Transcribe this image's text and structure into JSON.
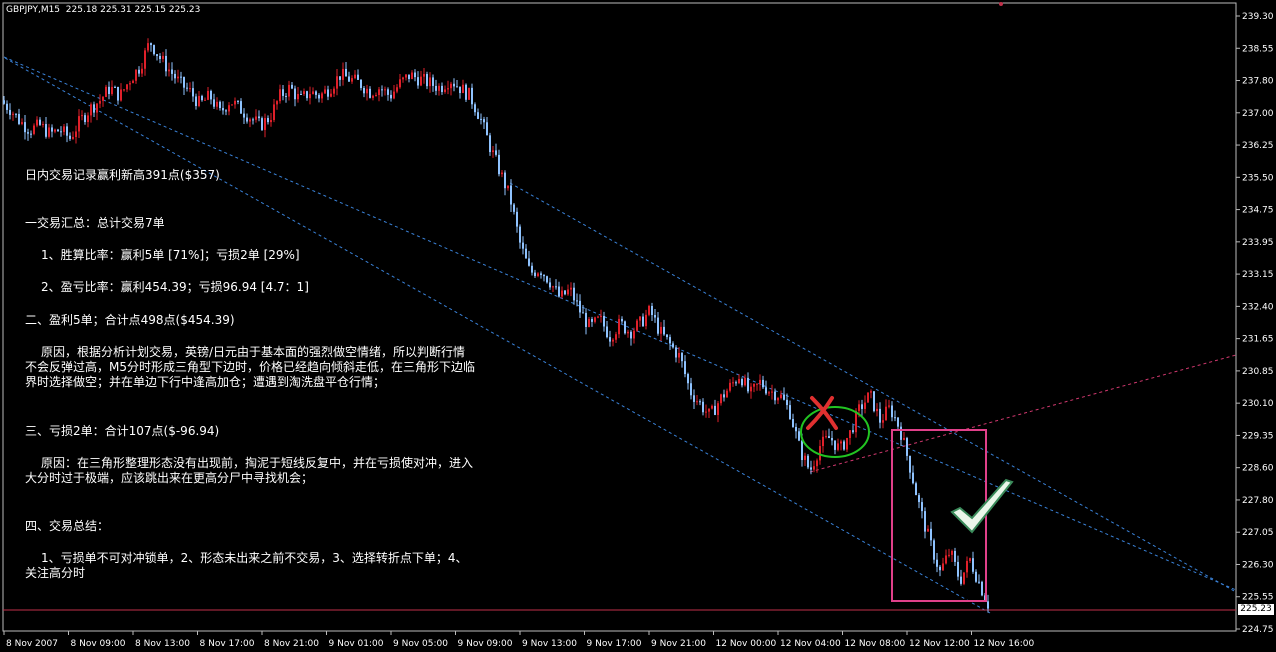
{
  "header": {
    "symbol": "GBPJPY,M15",
    "ohlc": "225.18 225.31 225.15 225.23"
  },
  "notes": {
    "title": "日内交易记录赢利新高391点($357)",
    "s1_title": "一交易汇总：总计交易7单",
    "s1_item1": "1、胜算比率：赢利5单 [71%]；亏损2单 [29%]",
    "s1_item2": "2、盈亏比率：赢利454.39；亏损96.94 [4.7：1]",
    "s2_title": "二、盈利5单；合计点498点($454.39)",
    "s2_reason": "原因，根据分析计划交易，英镑/日元由于基本面的强烈做空情绪，所以判断行情不会反弹过高，M5分时形成三角型下边时，价格已经趋向倾斜走低，在三角形下边临界时选择做空；并在单边下行中逢高加仓；遭遇到淘洗盘平仓行情；",
    "s3_title": "三、亏损2单：合计107点($-96.94)",
    "s3_reason": "原因：在三角形整理形态没有出现前，掏泥于短线反复中，并在亏损使对冲，进入大分时过于极端，应该跳出来在更高分尸中寻找机会；",
    "s4_title": "四、交易总结：",
    "s4_items": "1、亏损单不可对冲锁单，2、形态未出来之前不交易，3、选择转折点下单；4、关注高分时"
  },
  "current_price": "225.23",
  "chart_data": {
    "type": "candlestick",
    "symbol": "GBPJPY",
    "timeframe": "M15",
    "ylim": [
      224.75,
      239.3
    ],
    "y_ticks": [
      "239.30",
      "238.55",
      "237.80",
      "237.00",
      "236.25",
      "235.50",
      "234.75",
      "233.95",
      "233.15",
      "232.40",
      "231.65",
      "230.85",
      "230.10",
      "229.35",
      "228.60",
      "227.80",
      "227.05",
      "226.30",
      "225.55",
      "224.75"
    ],
    "x_ticks": [
      "8 Nov 2007",
      "8 Nov 09:00",
      "8 Nov 13:00",
      "8 Nov 17:00",
      "8 Nov 21:00",
      "9 Nov 01:00",
      "9 Nov 05:00",
      "9 Nov 09:00",
      "9 Nov 13:00",
      "9 Nov 17:00",
      "9 Nov 21:00",
      "12 Nov 00:00",
      "12 Nov 04:00",
      "12 Nov 08:00",
      "12 Nov 12:00",
      "12 Nov 16:00"
    ],
    "close_path": [
      [
        0,
        237.3
      ],
      [
        10,
        237.1
      ],
      [
        20,
        236.8
      ],
      [
        30,
        236.6
      ],
      [
        40,
        236.7
      ],
      [
        50,
        236.5
      ],
      [
        60,
        236.6
      ],
      [
        70,
        236.4
      ],
      [
        80,
        236.8
      ],
      [
        90,
        237.1
      ],
      [
        100,
        237.3
      ],
      [
        110,
        237.6
      ],
      [
        120,
        237.4
      ],
      [
        130,
        237.8
      ],
      [
        140,
        238.1
      ],
      [
        150,
        238.7
      ],
      [
        160,
        238.3
      ],
      [
        170,
        238.0
      ],
      [
        180,
        237.7
      ],
      [
        190,
        237.5
      ],
      [
        200,
        237.2
      ],
      [
        210,
        237.4
      ],
      [
        220,
        237.0
      ],
      [
        230,
        237.3
      ],
      [
        240,
        237.1
      ],
      [
        250,
        236.9
      ],
      [
        260,
        236.7
      ],
      [
        270,
        236.9
      ],
      [
        280,
        237.4
      ],
      [
        290,
        237.6
      ],
      [
        300,
        237.3
      ],
      [
        310,
        237.5
      ],
      [
        320,
        237.4
      ],
      [
        330,
        237.6
      ],
      [
        340,
        237.9
      ],
      [
        350,
        237.8
      ],
      [
        360,
        237.7
      ],
      [
        370,
        237.5
      ],
      [
        380,
        237.6
      ],
      [
        390,
        237.4
      ],
      [
        400,
        237.7
      ],
      [
        410,
        237.9
      ],
      [
        420,
        237.8
      ],
      [
        430,
        237.7
      ],
      [
        440,
        237.6
      ],
      [
        450,
        237.8
      ],
      [
        460,
        237.6
      ],
      [
        470,
        237.4
      ],
      [
        480,
        236.9
      ],
      [
        490,
        236.2
      ],
      [
        500,
        235.6
      ],
      [
        510,
        235.0
      ],
      [
        520,
        233.9
      ],
      [
        530,
        233.2
      ],
      [
        540,
        233.3
      ],
      [
        550,
        233.0
      ],
      [
        560,
        232.6
      ],
      [
        570,
        232.8
      ],
      [
        580,
        232.3
      ],
      [
        590,
        231.9
      ],
      [
        600,
        232.1
      ],
      [
        610,
        231.7
      ],
      [
        620,
        232.0
      ],
      [
        630,
        231.8
      ],
      [
        640,
        232.0
      ],
      [
        650,
        232.3
      ],
      [
        660,
        231.8
      ],
      [
        670,
        231.5
      ],
      [
        680,
        231.2
      ],
      [
        690,
        230.4
      ],
      [
        700,
        230.1
      ],
      [
        710,
        229.8
      ],
      [
        720,
        230.2
      ],
      [
        730,
        230.5
      ],
      [
        740,
        230.8
      ],
      [
        750,
        230.3
      ],
      [
        760,
        230.6
      ],
      [
        770,
        230.4
      ],
      [
        780,
        230.3
      ],
      [
        790,
        229.9
      ],
      [
        800,
        229.0
      ],
      [
        810,
        228.5
      ],
      [
        820,
        229.1
      ],
      [
        830,
        229.3
      ],
      [
        840,
        229.0
      ],
      [
        850,
        229.4
      ],
      [
        860,
        230.0
      ],
      [
        870,
        230.3
      ],
      [
        880,
        229.7
      ],
      [
        890,
        230.0
      ],
      [
        900,
        229.5
      ],
      [
        910,
        228.6
      ],
      [
        920,
        227.6
      ],
      [
        930,
        226.8
      ],
      [
        940,
        226.1
      ],
      [
        950,
        226.6
      ],
      [
        960,
        225.9
      ],
      [
        970,
        226.4
      ],
      [
        980,
        225.8
      ],
      [
        990,
        225.23
      ]
    ],
    "annotations": [
      "red-x",
      "green-ellipse",
      "green-checkmark",
      "pink-rectangle",
      "blue-dashed-channel",
      "pink-dashed-trendline"
    ]
  }
}
